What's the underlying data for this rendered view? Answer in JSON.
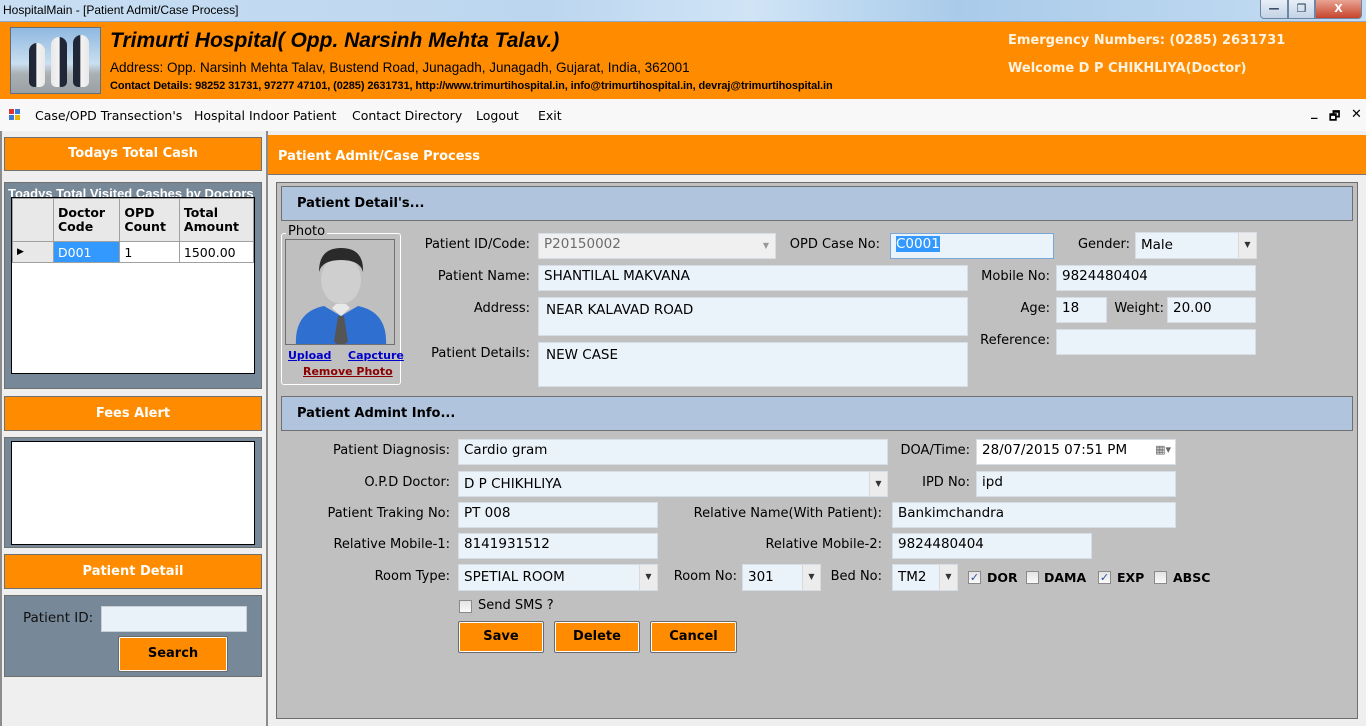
{
  "window": {
    "title": "HospitalMain - [Patient Admit/Case Process]",
    "controls": {
      "minimize": "—",
      "restore": "❐",
      "close": "X"
    }
  },
  "header": {
    "hospital_name": "Trimurti Hospital( Opp. Narsinh Mehta Talav.)",
    "address": "Address: Opp. Narsinh Mehta Talav, Bustend Road, Junagadh, Junagadh, Gujarat, India, 362001",
    "contact": "Contact Details: 98252 31731, 97277 47101, (0285) 2631731, http://www.trimurtihospital.in, info@trimurtihospital.in, devraj@trimurtihospital.in",
    "emergency": "Emergency Numbers: (0285) 2631731",
    "welcome": "Welcome D P CHIKHLIYA(Doctor)"
  },
  "menu": {
    "items": [
      "Case/OPD Transection's",
      "Hospital Indoor Patient",
      "Contact Directory",
      "Logout",
      "Exit"
    ],
    "mdi": {
      "minimize": "_",
      "restore": "🗗",
      "close": "✕"
    }
  },
  "sidebar": {
    "cash_title": "Todays Total Cash",
    "cash_caption": "Toadys Total Visited Cashes by Doctors",
    "grid": {
      "columns": [
        "Doctor Code",
        "OPD Count",
        "Total Amount"
      ],
      "rows": [
        {
          "doctor_code": "D001",
          "opd_count": "1",
          "total_amount": "1500.00"
        }
      ],
      "row_indicator": "▶"
    },
    "fees_title": "Fees Alert",
    "patient_title": "Patient Detail",
    "patient_id_label": "Patient ID:",
    "patient_id_value": "",
    "search_label": "Search"
  },
  "main": {
    "title": "Patient Admit/Case Process",
    "details_section": "Patient Detail's...",
    "photo": {
      "legend": "Photo",
      "upload": "Upload",
      "capture": "Capcture",
      "remove": "Remove Photo"
    },
    "fields": {
      "patient_id_label": "Patient ID/Code:",
      "patient_id": "P20150002",
      "opd_case_label": "OPD Case No:",
      "opd_case": "C0001",
      "gender_label": "Gender:",
      "gender": "Male",
      "patient_name_label": "Patient Name:",
      "patient_name": "SHANTILAL MAKVANA",
      "mobile_label": "Mobile No:",
      "mobile": "9824480404",
      "address_label": "Address:",
      "address": "NEAR KALAVAD ROAD",
      "age_label": "Age:",
      "age": "18",
      "weight_label": "Weight:",
      "weight": "20.00",
      "reference_label": "Reference:",
      "reference": "",
      "patient_details_label": "Patient Details:",
      "patient_details": "NEW CASE"
    },
    "admit_section": "Patient Admint Info...",
    "admit": {
      "diagnosis_label": "Patient Diagnosis:",
      "diagnosis": "Cardio gram",
      "doa_label": "DOA/Time:",
      "doa": "28/07/2015 07:51 PM",
      "doctor_label": "O.P.D Doctor:",
      "doctor": "D P CHIKHLIYA",
      "ipd_label": "IPD No:",
      "ipd": "ipd",
      "tracking_label": "Patient Traking No:",
      "tracking": "PT 008",
      "relative_name_label": "Relative Name(With Patient):",
      "relative_name": "Bankimchandra",
      "rel_mobile1_label": "Relative Mobile-1:",
      "rel_mobile1": "8141931512",
      "rel_mobile2_label": "Relative Mobile-2:",
      "rel_mobile2": "9824480404",
      "room_type_label": "Room Type:",
      "room_type": "SPETIAL ROOM",
      "room_no_label": "Room No:",
      "room_no": "301",
      "bed_no_label": "Bed No:",
      "bed_no": "TM2",
      "checks": [
        {
          "label": "DOR",
          "checked": true
        },
        {
          "label": "DAMA",
          "checked": false
        },
        {
          "label": "EXP",
          "checked": true
        },
        {
          "label": "ABSC",
          "checked": false
        }
      ],
      "send_sms_label": "Send SMS ?",
      "send_sms_checked": false
    },
    "buttons": {
      "save": "Save",
      "delete": "Delete",
      "cancel": "Cancel"
    }
  },
  "colors": {
    "accent_orange": "#ff8c00",
    "section_blue": "#b0c4de",
    "panel_gray": "#c0c0c0",
    "slate": "#778899",
    "selection_blue": "#3399ff",
    "link_blue": "#0000cc",
    "link_red": "#8b0000"
  }
}
